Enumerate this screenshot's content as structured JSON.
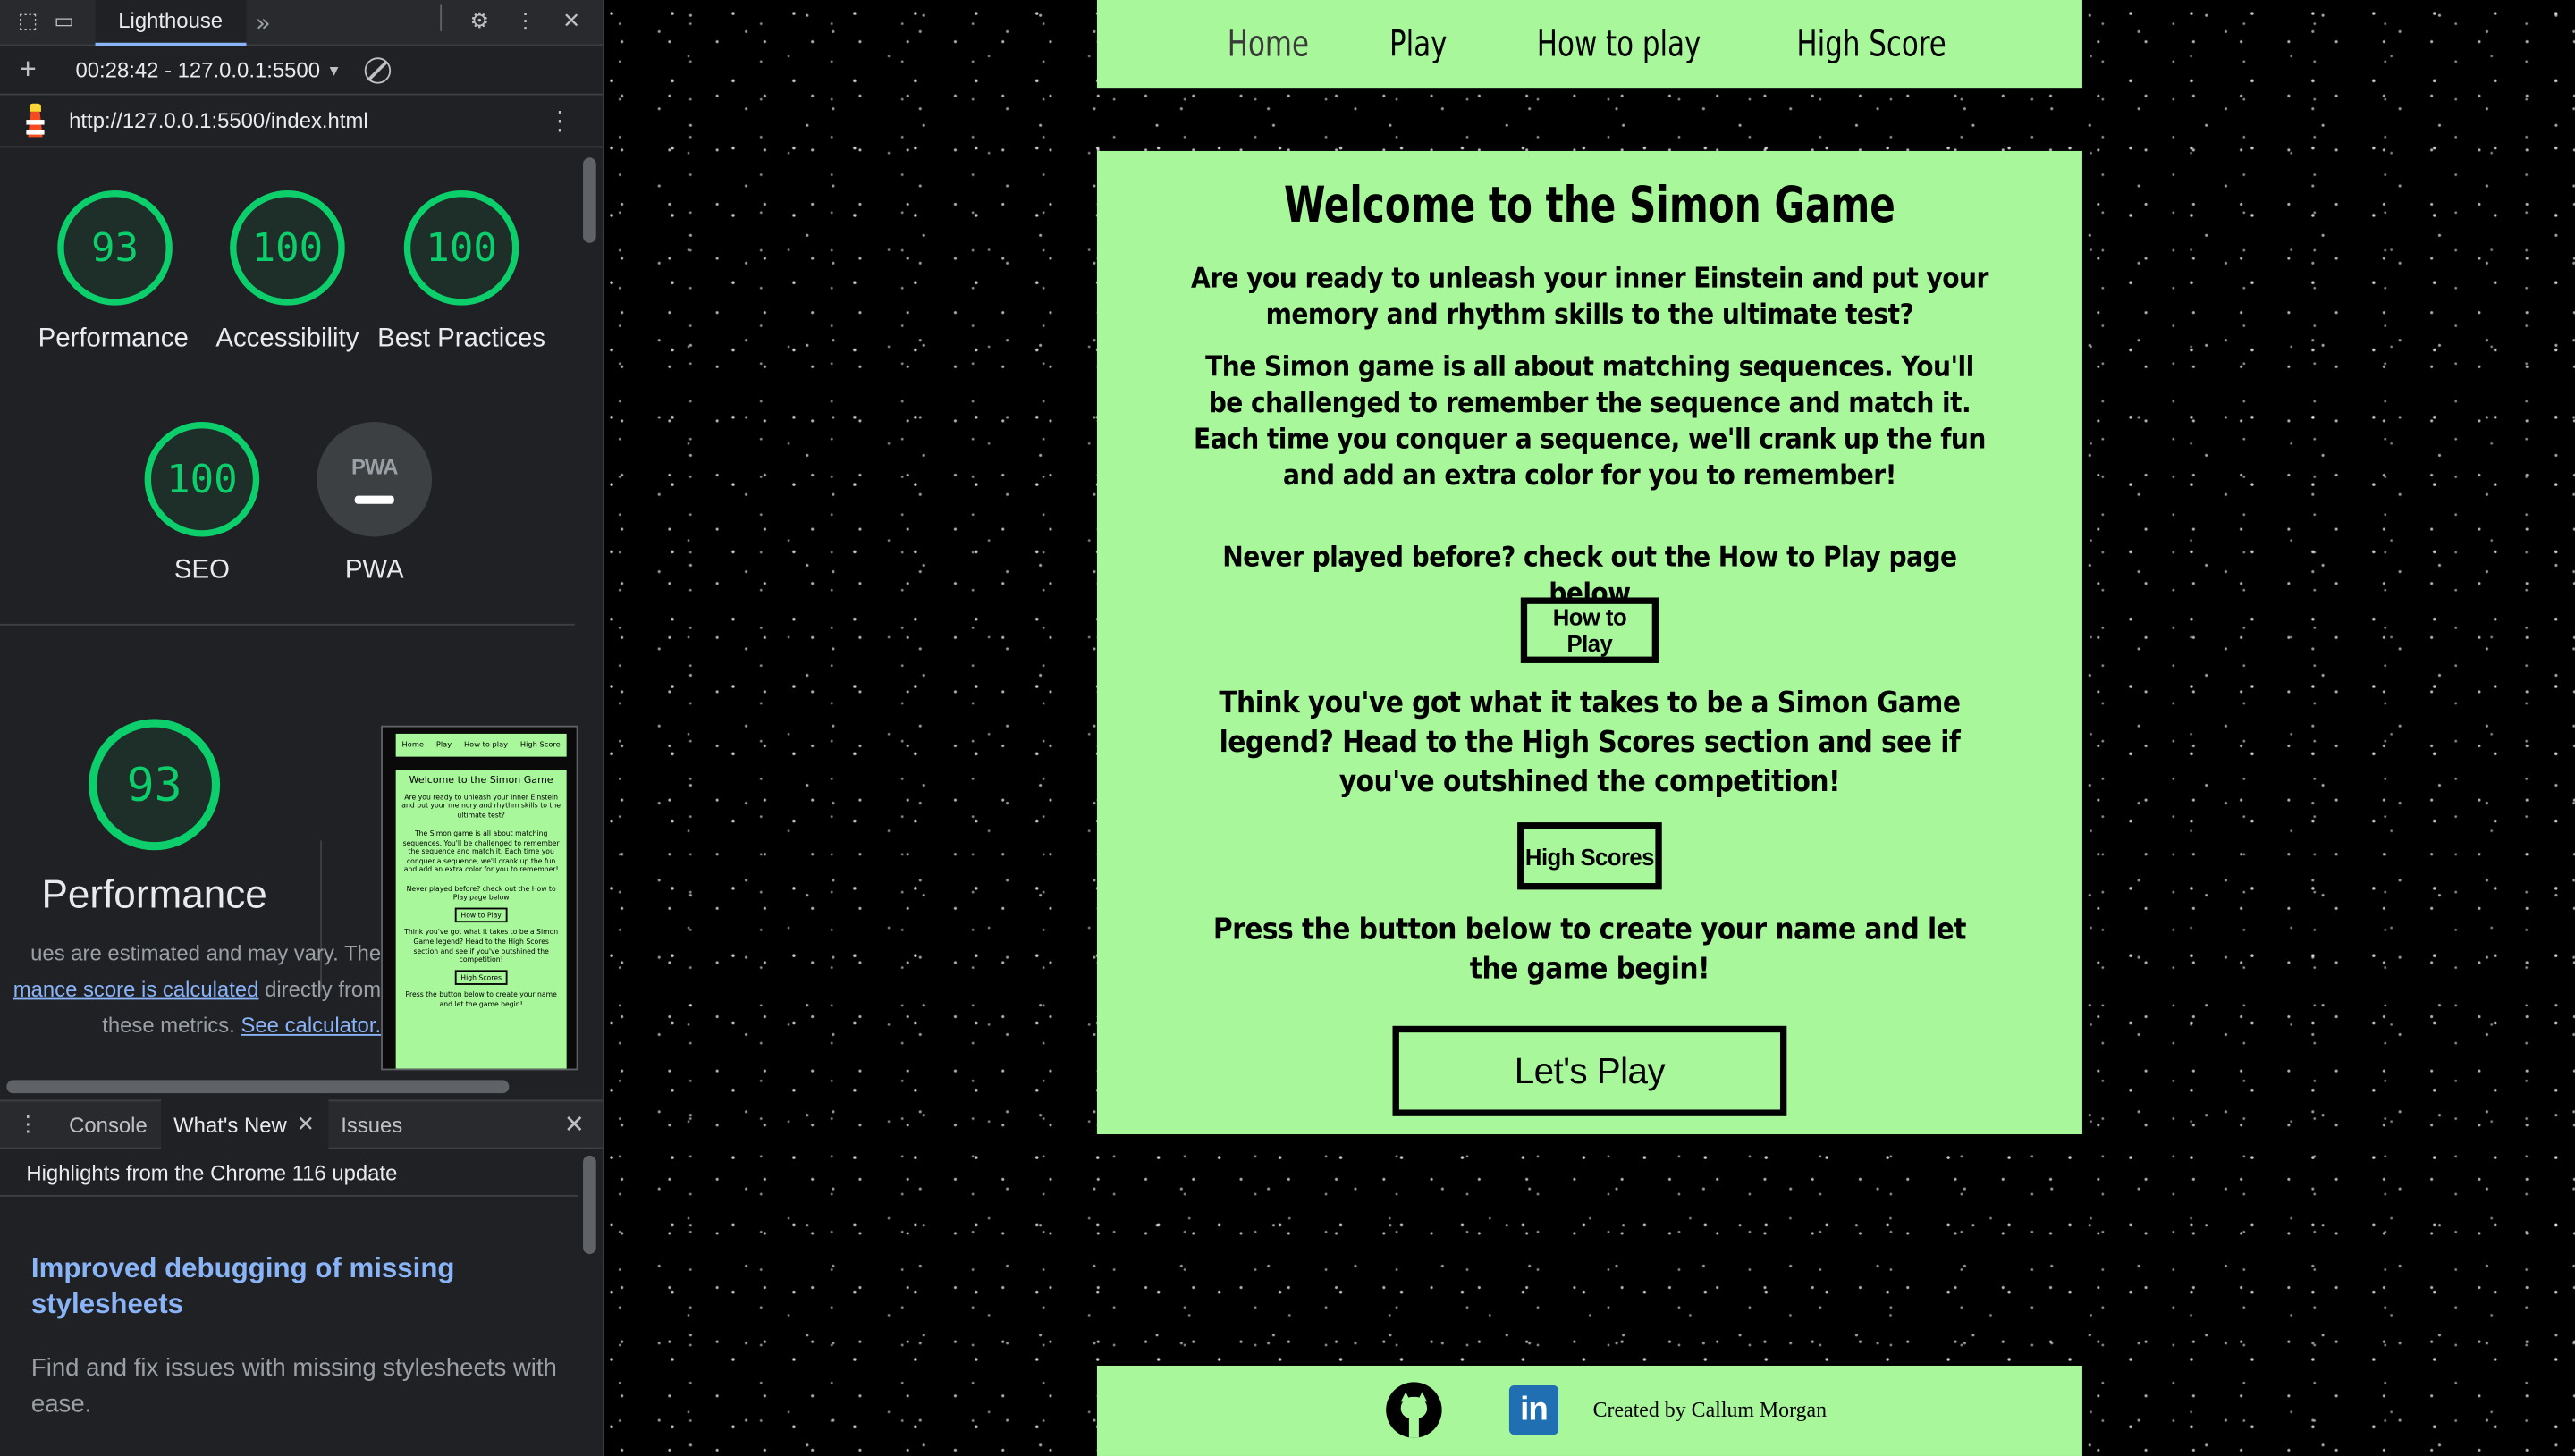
{
  "devtools": {
    "active_panel": "Lighthouse",
    "session": "00:28:42 - 127.0.0.1:5500",
    "report_url": "http://127.0.0.1:5500/index.html",
    "scores": [
      {
        "value": "93",
        "label": "Performance"
      },
      {
        "value": "100",
        "label": "Accessibility"
      },
      {
        "value": "100",
        "label": "Best Practices"
      },
      {
        "value": "100",
        "label": "SEO"
      }
    ],
    "pwa": {
      "badge": "PWA",
      "label": "PWA"
    },
    "performance": {
      "score": "93",
      "title": "Performance",
      "note_1": "ues are estimated and may vary. The",
      "note_link": "mance score is calculated",
      "note_2": "directly from",
      "note_3": "these metrics.",
      "calc_link": "See calculator."
    },
    "drawer": {
      "tabs": [
        "Console",
        "What's New",
        "Issues"
      ],
      "header": "Highlights from the Chrome 116 update",
      "article_title": "Improved debugging of missing stylesheets",
      "article_body": "Find and fix issues with missing stylesheets with ease."
    }
  },
  "site": {
    "nav": [
      "Home",
      "Play",
      "How to play",
      "High Score"
    ],
    "title": "Welcome to the Simon Game",
    "intro": "Are you ready to unleash your inner Einstein and put your memory and rhythm skills to the ultimate test?",
    "description": "The Simon game is all about matching sequences. You'll be challenged to remember the sequence and match it. Each time you conquer a sequence, we'll crank up the fun and add an extra color for you to remember!",
    "never_played": "Never played before? check out the How to Play page below",
    "how_to_play_button": "How to Play",
    "legend_text": "Think you've got what it takes to be a Simon Game legend? Head to the High Scores section and see if you've outshined the competition!",
    "high_scores_button": "High Scores",
    "press_text": "Press the button below to create your name and let the game begin!",
    "lets_play_button": "Let's Play",
    "footer_credit": "Created by Callum Morgan",
    "accent_color": "#a8f79b"
  }
}
